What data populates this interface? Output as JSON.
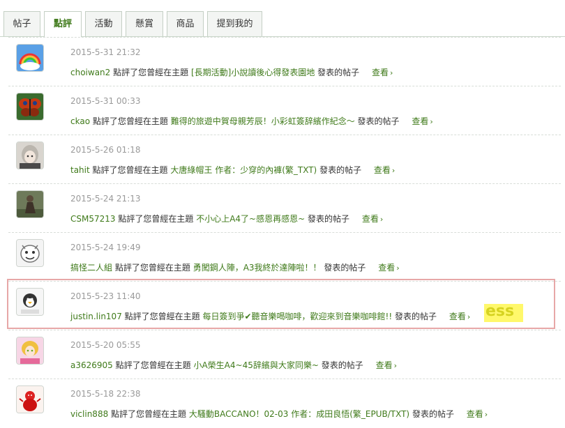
{
  "tabs": [
    {
      "label": "帖子",
      "active": false
    },
    {
      "label": "點評",
      "active": true
    },
    {
      "label": "活動",
      "active": false
    },
    {
      "label": "懸賞",
      "active": false
    },
    {
      "label": "商品",
      "active": false
    },
    {
      "label": "提到我的",
      "active": false
    }
  ],
  "template": {
    "commented": "點評了您曾經在主題",
    "posted": "發表的帖子",
    "view": "查看",
    "chevron": "›"
  },
  "items": [
    {
      "time": "2015-5-31 21:32",
      "user": "choiwan2",
      "topic": "[長期活動]小說讀後心得發表園地",
      "avatar": "rainbow-avatar"
    },
    {
      "time": "2015-5-31 00:33",
      "user": "ckao",
      "topic": "難得的旅遊中賀母親芳辰！小彩虹簽辞繽作紀念～",
      "avatar": "butterfly-avatar"
    },
    {
      "time": "2015-5-26 01:18",
      "user": "tahit",
      "topic": "大唐綠帽王 作者：少穿的內褲(繁_TXT)",
      "avatar": "anime-girl-avatar"
    },
    {
      "time": "2015-5-24 21:13",
      "user": "CSM57213",
      "topic": "不小心上A4了~感恩再感恩~",
      "avatar": "figure-avatar"
    },
    {
      "time": "2015-5-24 19:49",
      "user": "搞怪二人組",
      "topic": "勇闖鋼人陣，A3我終於達陣啦！！",
      "avatar": "cartoon-face-avatar"
    },
    {
      "time": "2015-5-23 11:40",
      "user": "justin.lin107",
      "topic": "每日簽到爭✔聽音樂喝咖啡，歡迎來到音樂咖啡館!!",
      "avatar": "penguin-avatar"
    },
    {
      "time": "2015-5-20 05:55",
      "user": "a3626905",
      "topic": "小A榮生A4~45辞繽與大家同樂~",
      "avatar": "pink-girl-avatar"
    },
    {
      "time": "2015-5-18 22:38",
      "user": "viclin888",
      "topic": "大騷動BACCANO！02-03 作者：成田良悟(繁_EPUB/TXT)",
      "avatar": "red-doll-avatar"
    }
  ],
  "highlight_tag": "ess",
  "colors": {
    "accent_green": "#3f7a1a",
    "time_gray": "#9a9a9a",
    "highlight_border": "#e7a7a7",
    "highlight_yellow": "#fff86b"
  }
}
